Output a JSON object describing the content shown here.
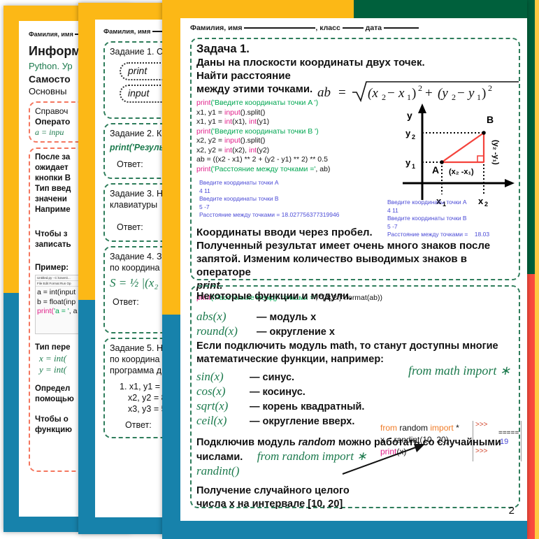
{
  "colors": {
    "gold": "#fcb816",
    "blue": "#1782ab",
    "green": "#00603c",
    "red": "#fb4b3e",
    "dash_green": "#2e7d5b",
    "dash_red": "#f4765e",
    "code_magenta": "#e0218a",
    "code_green": "#00a651",
    "output_blue": "#4a4ad6"
  },
  "page1": {
    "nameline": "Фамилия, имя",
    "title": "Информ",
    "subtitle_green": "Python. Ур",
    "bold_line": "Самосто",
    "line4": "Основны",
    "box1": {
      "l1": "Справоч",
      "l2": "Операто",
      "l3": "a = inpu"
    },
    "box2": {
      "l1": "После за",
      "l2": "ожидает",
      "l3": "кнопки В",
      "l4": "Тип введ",
      "l5": "значени",
      "l6": "Наприме",
      "l7": "Чтобы з",
      "l8": "записать",
      "l9": "Пример:",
      "code": {
        "titlebar": "Untitled.py - C:\\Users\\...",
        "menubar": "File  Edit  Format  Run  Op",
        "c1": "a = int(input",
        "c2": "b = float(inp",
        "c3_pre": "print(",
        "c3_str": "'a = '",
        "c3_post": ", a"
      },
      "l10": "Тип пере",
      "m1": "x = int(",
      "m2": "y = int(",
      "l11": "Определ",
      "l12": "помощью",
      "l13": "Чтобы о",
      "l14": "функцию"
    }
  },
  "page2": {
    "nameline": "Фамилия, имя",
    "tasks": [
      {
        "heading": "Задание 1. С",
        "chips": [
          "print",
          "input"
        ]
      },
      {
        "heading": "Задание 2. К",
        "code": "print('Резуль",
        "answer": "Ответ:"
      },
      {
        "heading_l1": "Задание 3. Н",
        "heading_l2": "клавиатуры",
        "answer": "Ответ:"
      },
      {
        "heading_l1": "Задание 4. З",
        "heading_l2": "по координа",
        "formula": "S = ½ |(x₂ ",
        "answer": "Ответ:"
      },
      {
        "heading_l1": "Задание 5. Н",
        "heading_l2": "по координа",
        "heading_l3": "программа д",
        "items": [
          "1. x1, y1 = 1",
          "x2, y2 = 8",
          "x3, y3 = 5"
        ],
        "answer": "Ответ:"
      }
    ]
  },
  "page3": {
    "nameline": {
      "part1": "Фамилия, имя",
      "part2": ", класс",
      "part3": "дата"
    },
    "task1": {
      "heading": "Задача 1.",
      "text_l1": "Даны на плоскости координаты двух точек. Найти расстояние",
      "text_l2": "между этими точками.",
      "code": [
        {
          "t": "print",
          "c": "k-print"
        },
        {
          "t": "('Введите координаты точки A ')",
          "c": "k-str"
        }
      ],
      "code_lines": [
        "print('Введите координаты точки A ')",
        "x1, y1 = input().split()",
        "x1, y1 = int(x1), int(y1)",
        "print('Введите координаты точки B ')",
        "x2, y2 = input().split()",
        "x2, y2 = int(x2), int(y2)",
        "ab = ((x2 - x1) ** 2 + (y2 - y1) ** 2) ** 0.5",
        "print('Расстояние между точками =', ab)"
      ],
      "output_lines": [
        "Введите координаты точки A",
        "4 11",
        "Введите координаты точки B",
        "5 -7",
        "Расстояние между точками = 18.027756377319946"
      ],
      "formula": "ab = √((x₂ − x₁)² + (y₂ − y₁)²)",
      "diagram": {
        "axis_y": "y",
        "point_b": "B",
        "point_a": "A",
        "tick_y2": "y₂",
        "tick_y1": "y₁",
        "tick_x1": "x₁",
        "tick_x2": "x₂",
        "leg_horizontal": "(x₂ -x₁)",
        "leg_vertical": "(y₂ -y₁)"
      },
      "note_l1": "Координаты вводи через пробел.",
      "note_l2": "Полученный результат имеет очень много знаков после",
      "note_l3": "запятой. Изменим количество выводимых знаков в операторе",
      "note_l4_italic": "print",
      "note_l4_dot": ".",
      "code2": "print('Расстояние между точками =', \"{:8.2f}\".format(ab))",
      "output2_lines": [
        "Введите координаты точки A",
        "4 11",
        "Введите координаты точки B",
        "5 -7",
        "Расстояние между точками =    18.03"
      ]
    },
    "functions_box": {
      "heading": "Некоторые функции и модули.",
      "rows": [
        {
          "fn": "abs(x)",
          "desc": "— модуль x"
        },
        {
          "fn": "round(x)",
          "desc": "— округление x"
        }
      ],
      "math_l1": "Если подключить модуль math, то станут доступны многие",
      "math_l2": "математические функции, например:",
      "math_rows": [
        {
          "fn": "sin(x)",
          "desc": "— синус."
        },
        {
          "fn": "cos(x)",
          "desc": "— косинус."
        },
        {
          "fn": "sqrt(x)",
          "desc": "— корень квадратный."
        },
        {
          "fn": "ceil(x)",
          "desc": "— округление вверх."
        }
      ],
      "math_import": "from math import ∗",
      "random_l1_a": "Подключив модуль ",
      "random_l1_i": "random",
      "random_l1_b": " можно работать со случайными",
      "random_l2": "числами.",
      "random_import": "from random import ∗",
      "randint": "randint()",
      "random_l3": "Получение случайного целого",
      "random_l4": "числа x на интервале [10, 20]",
      "snippet": {
        "l1_from": "from",
        "l1_mod": "random",
        "l1_import": "import",
        "l1_star": "*",
        "l2": "x = randint(10, 20)",
        "l3_print": "print",
        "l3_arg": "(x)",
        "console_prompt1": ">>>",
        "console_eq": "=====",
        "console_val": "19",
        "console_prompt2": ">>>"
      }
    },
    "page_number": "2"
  }
}
